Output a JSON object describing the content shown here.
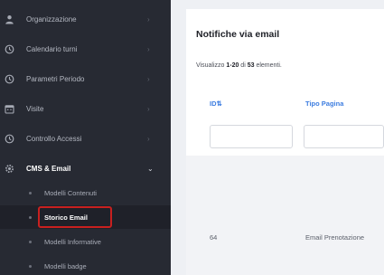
{
  "sidebar": {
    "items": [
      {
        "label": "Organizzazione",
        "icon": "user-icon"
      },
      {
        "label": "Calendario turni",
        "icon": "clock-icon"
      },
      {
        "label": "Parametri Periodo",
        "icon": "clock-icon"
      },
      {
        "label": "Visite",
        "icon": "calendar-icon"
      },
      {
        "label": "Controllo Accessi",
        "icon": "clock-icon"
      },
      {
        "label": "CMS & Email",
        "icon": "gear-icon"
      }
    ],
    "cms_submenu": [
      {
        "label": "Modelli Contenuti"
      },
      {
        "label": "Storico Email"
      },
      {
        "label": "Modelli Informative"
      },
      {
        "label": "Modelli badge"
      }
    ],
    "chevron_right": "›",
    "chevron_down": "⌄"
  },
  "main": {
    "title": "Notifiche via email",
    "summary": {
      "prefix": "Visualizzo ",
      "range": "1-20",
      "middle": " di ",
      "total": "53",
      "suffix": " elementi."
    },
    "columns": [
      "ID⇅",
      "Tipo Pagina"
    ],
    "rows": [
      {
        "id": "64",
        "tipo_pagina": "Email Prenotazione"
      }
    ]
  },
  "colors": {
    "sidebar_bg": "#272a33",
    "accent_link": "#3d7de0",
    "selection_border": "#c8201f"
  }
}
